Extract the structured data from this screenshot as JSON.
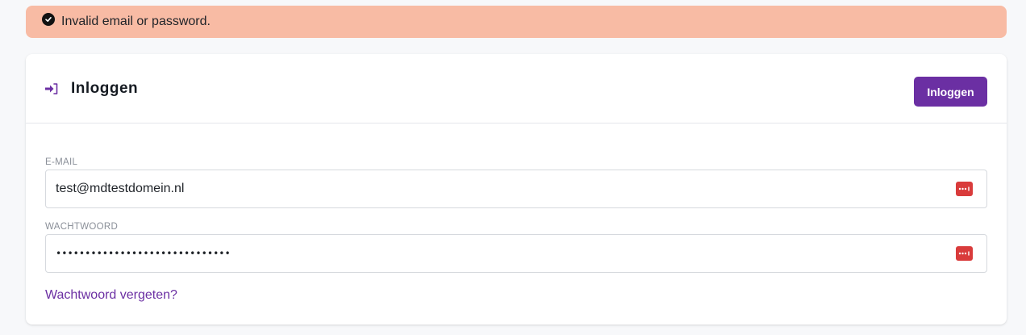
{
  "alert": {
    "message": "Invalid email or password.",
    "icon": "check-circle-icon",
    "color": "#f8bba4"
  },
  "card": {
    "title": "Inloggen",
    "title_icon": "sign-in-icon",
    "submit_label": "Inloggen",
    "accent_color": "#6b2fa3"
  },
  "form": {
    "email": {
      "label": "E-MAIL",
      "value": "test@mdtestdomein.nl"
    },
    "password": {
      "label": "WACHTWOORD",
      "value": "••••••••••••••••••••••••••••••"
    },
    "password_manager_icon": "password-manager-icon",
    "forgot_link": "Wachtwoord vergeten?"
  }
}
